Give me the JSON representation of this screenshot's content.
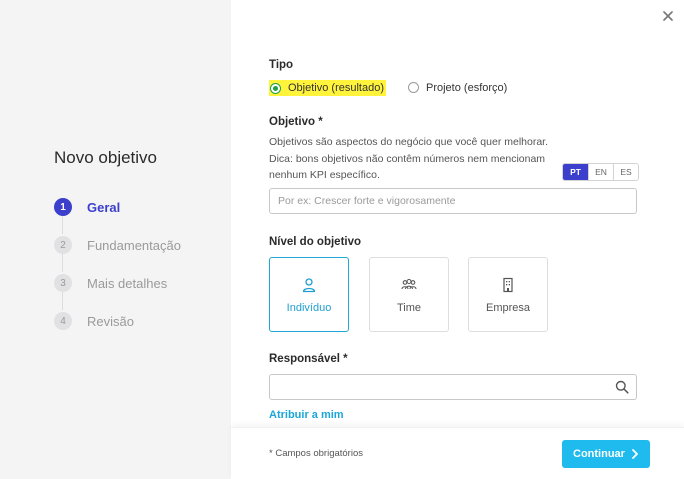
{
  "sidebar": {
    "title": "Novo objetivo",
    "steps": [
      {
        "number": "1",
        "label": "Geral"
      },
      {
        "number": "2",
        "label": "Fundamentação"
      },
      {
        "number": "3",
        "label": "Mais detalhes"
      },
      {
        "number": "4",
        "label": "Revisão"
      }
    ]
  },
  "form": {
    "tipo": {
      "label": "Tipo",
      "options": [
        "Objetivo (resultado)",
        "Projeto (esforço)"
      ],
      "selected": "Objetivo (resultado)"
    },
    "objetivo": {
      "label": "Objetivo *",
      "help": "Objetivos são aspectos do negócio que você quer melhorar. Dica: bons objetivos não contêm números nem mencionam nenhum KPI específico.",
      "languages": [
        "PT",
        "EN",
        "ES"
      ],
      "selected_language": "PT",
      "placeholder": "Por ex: Crescer forte e vigorosamente",
      "value": ""
    },
    "nivel": {
      "label": "Nível do objetivo",
      "options": [
        {
          "label": "Indivíduo",
          "icon": "person-icon"
        },
        {
          "label": "Time",
          "icon": "team-icon"
        },
        {
          "label": "Empresa",
          "icon": "building-icon"
        }
      ],
      "selected": "Indivíduo"
    },
    "responsavel": {
      "label": "Responsável *",
      "value": "",
      "assign_link": "Atribuir a mim"
    }
  },
  "footer": {
    "required_note": "* Campos obrigatórios",
    "continue_label": "Continuar"
  },
  "colors": {
    "primary": "#3b3fcb",
    "accent": "#1fbbee",
    "highlight": "#fff33b",
    "radio_selected": "#1f9f46"
  }
}
